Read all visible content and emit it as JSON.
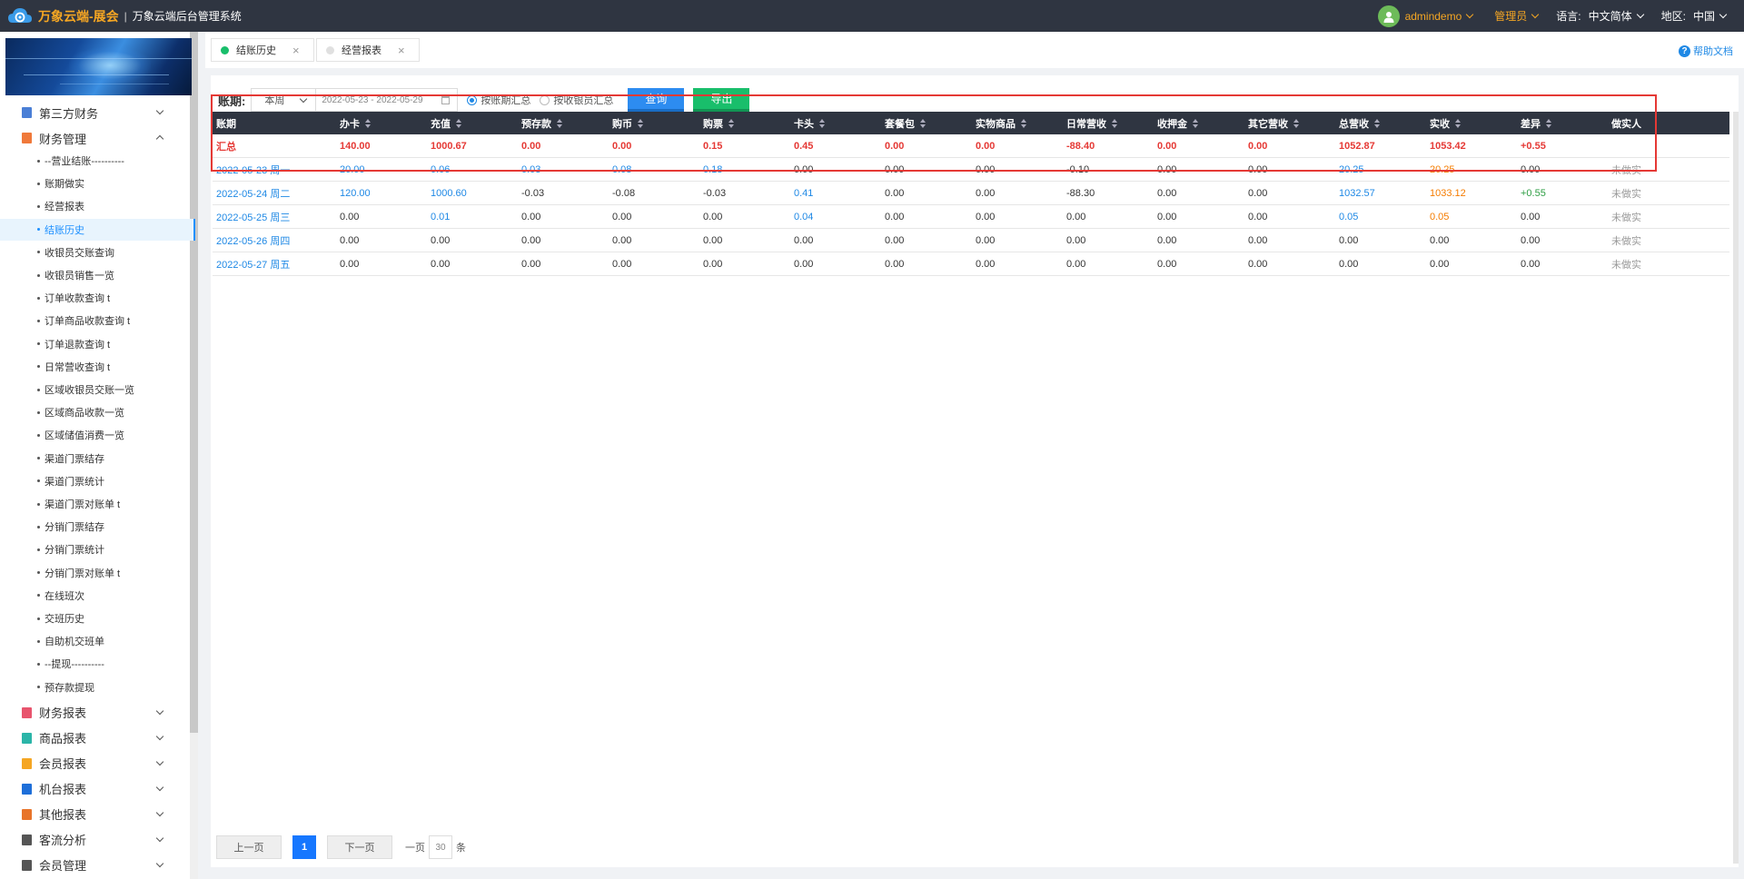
{
  "header": {
    "brand": "万象云端-展会",
    "separator": "|",
    "system_name": "万象云端后台管理系统",
    "user": "admindemo",
    "role": "管理员",
    "language_label": "语言:",
    "language_value": "中文简体",
    "region_label": "地区:",
    "region_value": "中国"
  },
  "sidebar": {
    "groups_top": [
      {
        "label": "第三方财务",
        "icon": "doc-icon",
        "color": "#4a7fd6"
      },
      {
        "label": "财务管理",
        "icon": "ledger-icon",
        "color": "#f0793a"
      }
    ],
    "finance_items": [
      "--营业结账----------",
      "账期做实",
      "经营报表",
      "结账历史",
      "收银员交账查询",
      "收银员销售一览",
      "订单收款查询 t",
      "订单商品收款查询 t",
      "订单退款查询 t",
      "日常营收查询 t",
      "区域收银员交账一览",
      "区域商品收款一览",
      "区域储值消费一览",
      "渠道门票结存",
      "渠道门票统计",
      "渠道门票对账单 t",
      "分销门票结存",
      "分销门票统计",
      "分销门票对账单 t",
      "在线班次",
      "交班历史",
      "自助机交班单",
      "--提现----------",
      "预存款提现"
    ],
    "active_item": "结账历史",
    "groups_bottom": [
      {
        "label": "财务报表",
        "icon": "chart-icon",
        "color": "#e8546d"
      },
      {
        "label": "商品报表",
        "icon": "box-icon",
        "color": "#2bb5a8"
      },
      {
        "label": "会员报表",
        "icon": "member-icon",
        "color": "#f5a623"
      },
      {
        "label": "机台报表",
        "icon": "machine-icon",
        "color": "#1e6fd9"
      },
      {
        "label": "其他报表",
        "icon": "layers-icon",
        "color": "#e8742a"
      },
      {
        "label": "客流分析",
        "icon": "target-icon",
        "color": "#555555"
      },
      {
        "label": "会员管理",
        "icon": "user-icon",
        "color": "#555555"
      }
    ]
  },
  "tabs": [
    {
      "label": "结账历史",
      "dot": "#19be6b"
    },
    {
      "label": "经营报表",
      "dot": "#e0e0e0"
    }
  ],
  "help_label": "帮助文档",
  "filter": {
    "label": "账期:",
    "period": "本周",
    "date_range": "2022-05-23 - 2022-05-29",
    "radio1": "按账期汇总",
    "radio2": "按收银员汇总",
    "query_btn": "查询",
    "export_btn": "导出"
  },
  "table": {
    "headers": [
      "账期",
      "办卡",
      "充值",
      "预存款",
      "购币",
      "购票",
      "卡头",
      "套餐包",
      "实物商品",
      "日常营收",
      "收押金",
      "其它营收",
      "总营收",
      "实收",
      "差异",
      "做实人"
    ],
    "rows": [
      [
        "汇总",
        "140.00",
        "1000.67",
        "0.00",
        "0.00",
        "0.15",
        "0.45",
        "0.00",
        "0.00",
        "-88.40",
        "0.00",
        "0.00",
        "1052.87",
        "1053.42",
        "+0.55",
        ""
      ],
      [
        "2022-05-23 周一",
        "20.00",
        "0.06",
        "0.03",
        "0.08",
        "0.18",
        "0.00",
        "0.00",
        "0.00",
        "-0.10",
        "0.00",
        "0.00",
        "20.25",
        "20.25",
        "0.00",
        "未做实"
      ],
      [
        "2022-05-24 周二",
        "120.00",
        "1000.60",
        "-0.03",
        "-0.08",
        "-0.03",
        "0.41",
        "0.00",
        "0.00",
        "-88.30",
        "0.00",
        "0.00",
        "1032.57",
        "1033.12",
        "+0.55",
        "未做实"
      ],
      [
        "2022-05-25 周三",
        "0.00",
        "0.01",
        "0.00",
        "0.00",
        "0.00",
        "0.04",
        "0.00",
        "0.00",
        "0.00",
        "0.00",
        "0.00",
        "0.05",
        "0.05",
        "0.00",
        "未做实"
      ],
      [
        "2022-05-26 周四",
        "0.00",
        "0.00",
        "0.00",
        "0.00",
        "0.00",
        "0.00",
        "0.00",
        "0.00",
        "0.00",
        "0.00",
        "0.00",
        "0.00",
        "0.00",
        "0.00",
        "未做实"
      ],
      [
        "2022-05-27 周五",
        "0.00",
        "0.00",
        "0.00",
        "0.00",
        "0.00",
        "0.00",
        "0.00",
        "0.00",
        "0.00",
        "0.00",
        "0.00",
        "0.00",
        "0.00",
        "0.00",
        "未做实"
      ]
    ]
  },
  "pager": {
    "prev": "上一页",
    "current": "1",
    "next": "下一页",
    "per_page_label": "一页",
    "per_page": "30",
    "unit": "条"
  }
}
